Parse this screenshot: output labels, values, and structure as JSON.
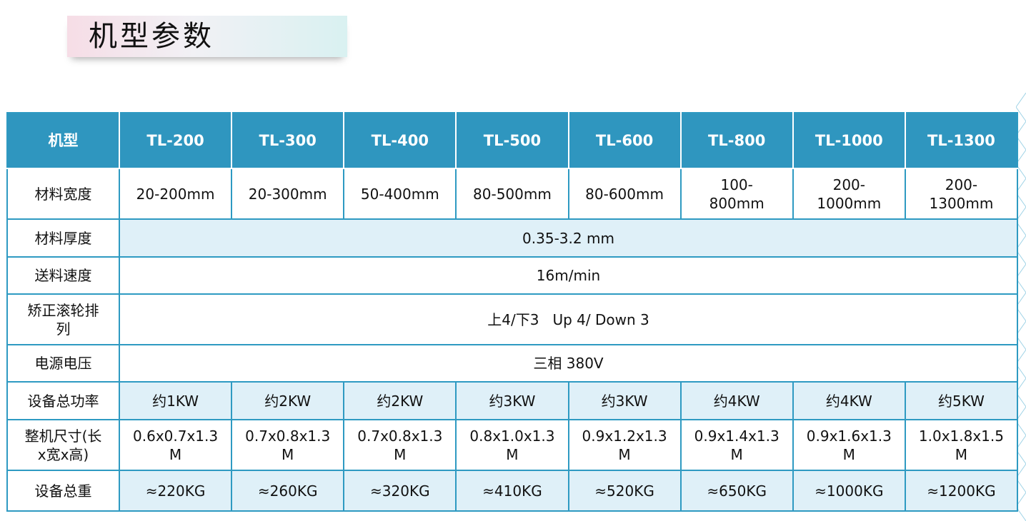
{
  "title": "机型参数",
  "header": {
    "label": "机型",
    "models": [
      "TL-200",
      "TL-300",
      "TL-400",
      "TL-500",
      "TL-600",
      "TL-800",
      "TL-1000",
      "TL-1300"
    ]
  },
  "rows": {
    "width": {
      "label": "材料宽度",
      "values": [
        "20-200mm",
        "20-300mm",
        "50-400mm",
        "80-500mm",
        "80-600mm",
        "100-800mm",
        "200-1000mm",
        "200-1300mm"
      ]
    },
    "thickness": {
      "label": "材料厚度",
      "value": "0.35-3.2 mm"
    },
    "speed": {
      "label": "送料速度",
      "value": "16m/min"
    },
    "rollers": {
      "label": "矫正滚轮排列",
      "value": "上4/下3   Up 4/ Down 3"
    },
    "voltage": {
      "label": "电源电压",
      "value": "三相 380V"
    },
    "power": {
      "label": "设备总功率",
      "values": [
        "约1KW",
        "约2KW",
        "约2KW",
        "约3KW",
        "约3KW",
        "约4KW",
        "约4KW",
        "约5KW"
      ]
    },
    "size": {
      "label": "整机尺寸(长x宽x高)",
      "values": [
        "0.6x0.7x1.3 M",
        "0.7x0.8x1.3 M",
        "0.7x0.8x1.3 M",
        "0.8x1.0x1.3 M",
        "0.9x1.2x1.3 M",
        "0.9x1.4x1.3 M",
        "0.9x1.6x1.3 M",
        "1.0x1.8x1.5 M"
      ]
    },
    "weight": {
      "label": "设备总重",
      "values": [
        "≈220KG",
        "≈260KG",
        "≈320KG",
        "≈410KG",
        "≈520KG",
        "≈650KG",
        "≈1000KG",
        "≈1200KG"
      ]
    }
  },
  "colors": {
    "header_bg": "#2f96bf",
    "border": "#2e9ac2",
    "stripe": "#dff0f8"
  }
}
